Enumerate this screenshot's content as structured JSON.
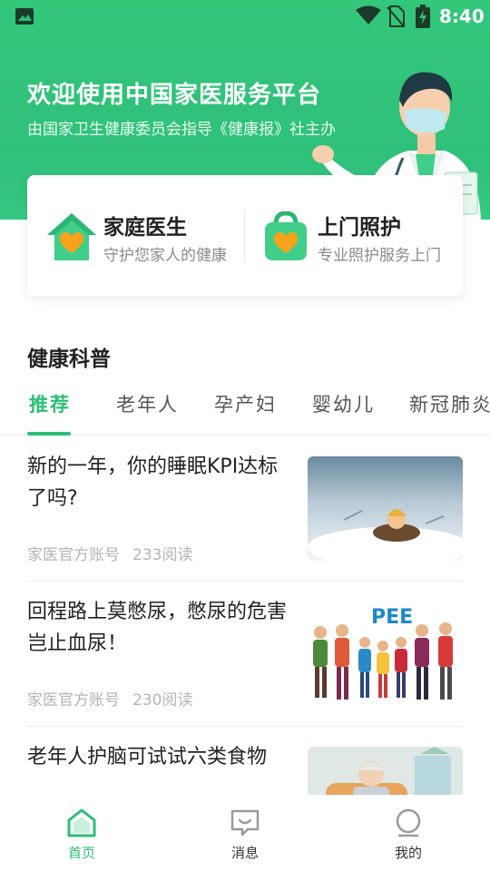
{
  "status_bar": {
    "time": "8:40"
  },
  "hero": {
    "title": "欢迎使用中国家医服务平台",
    "subtitle": "由国家卫生健康委员会指导《健康报》社主办"
  },
  "services": [
    {
      "title": "家庭医生",
      "desc": "守护您家人的健康",
      "icon": "house-heart-icon"
    },
    {
      "title": "上门照护",
      "desc": "专业照护服务上门",
      "icon": "bag-heart-icon"
    }
  ],
  "section_title": "健康科普",
  "tabs": [
    {
      "label": "推荐",
      "active": true
    },
    {
      "label": "老年人",
      "active": false
    },
    {
      "label": "孕产妇",
      "active": false
    },
    {
      "label": "婴幼儿",
      "active": false
    },
    {
      "label": "新冠肺炎",
      "active": false
    }
  ],
  "articles": [
    {
      "title": "新的一年，你的睡眠KPI达标了吗?",
      "author": "家医官方账号",
      "reads": "233阅读"
    },
    {
      "title": "回程路上莫憋尿，憋尿的危害岂止血尿！",
      "author": "家医官方账号",
      "reads": "230阅读",
      "image_text": "PEE"
    },
    {
      "title": "老年人护脑可试试六类食物",
      "author": "",
      "reads": ""
    }
  ],
  "bottom_nav": [
    {
      "label": "首页",
      "icon": "home-icon",
      "active": true
    },
    {
      "label": "消息",
      "icon": "message-icon",
      "active": false
    },
    {
      "label": "我的",
      "icon": "profile-icon",
      "active": false
    }
  ],
  "colors": {
    "brand_green": "#2dbe76",
    "hero_green": "#33c77a",
    "heart_orange": "#f7a21b"
  }
}
